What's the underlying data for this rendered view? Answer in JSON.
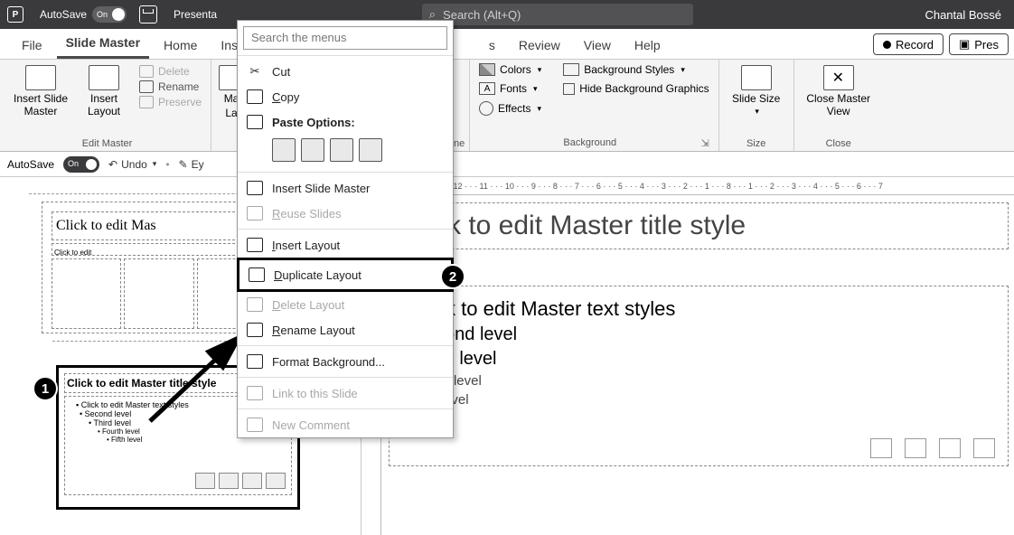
{
  "titlebar": {
    "autosave_label": "AutoSave",
    "autosave_state": "On",
    "doc_title": "Presenta",
    "search_placeholder": "Search (Alt+Q)",
    "user": "Chantal Bossé"
  },
  "tabs": {
    "file": "File",
    "slide_master": "Slide Master",
    "home": "Home",
    "insert_partial": "Inse",
    "s_partial": "s",
    "review": "Review",
    "view": "View",
    "help": "Help",
    "record": "Record",
    "present_partial": "Pres"
  },
  "ribbon": {
    "insert_slide_master": "Insert Slide Master",
    "insert_layout": "Insert Layout",
    "delete": "Delete",
    "rename": "Rename",
    "preserve": "Preserve",
    "edit_master_group": "Edit Master",
    "mas_partial": "Mas",
    "lay_partial": "Lay",
    "ne_partial": "ne",
    "colors": "Colors",
    "fonts": "Fonts",
    "effects": "Effects",
    "bg_styles": "Background Styles",
    "hide_bg": "Hide Background Graphics",
    "background_group": "Background",
    "slide_size": "Slide Size",
    "size_group": "Size",
    "close_master": "Close Master View",
    "close_group": "Close"
  },
  "qat": {
    "autosave": "AutoSave",
    "on": "On",
    "undo": "Undo",
    "eye_partial": "Ey"
  },
  "thumbs": {
    "master_title": "Click to edit Mas",
    "master_sub": "Click to edit",
    "layout_title": "Click to edit Master title style",
    "layout_bullets": {
      "l1": "Click to edit Master text styles",
      "l2": "Second level",
      "l3": "Third level",
      "l4": "Fourth level",
      "l5": "Fifth level"
    }
  },
  "editor": {
    "title": "Click to edit Master title style",
    "b1": "Click to edit Master text styles",
    "b2": "Second level",
    "b3": "Third level",
    "b4": "Fourth level",
    "b5": "Fifth level"
  },
  "ctx": {
    "search": "Search the menus",
    "cut": "Cut",
    "copy": "Copy",
    "paste_options": "Paste Options:",
    "insert_slide_master": "Insert Slide Master",
    "reuse_slides": "Reuse Slides",
    "insert_layout": "Insert Layout",
    "duplicate_layout": "Duplicate Layout",
    "delete_layout": "Delete Layout",
    "rename_layout": "Rename Layout",
    "format_background": "Format Background...",
    "link_to_slide": "Link to this Slide",
    "new_comment": "New Comment"
  },
  "annotations": {
    "one": "1",
    "two": "2"
  },
  "ruler": "· 15 · · · 14 · · · 13 · · · 12 · · · 11 · · · 10 · · · 9 · · · 8 · · · 7 · · · 6 · · · 5 · · · 4 · · · 3 · · · 2 · · · 1 · · · 8 · · · 1 · · · 2 · · · 3 · · · 4 · · · 5 · · · 6 · · · 7"
}
